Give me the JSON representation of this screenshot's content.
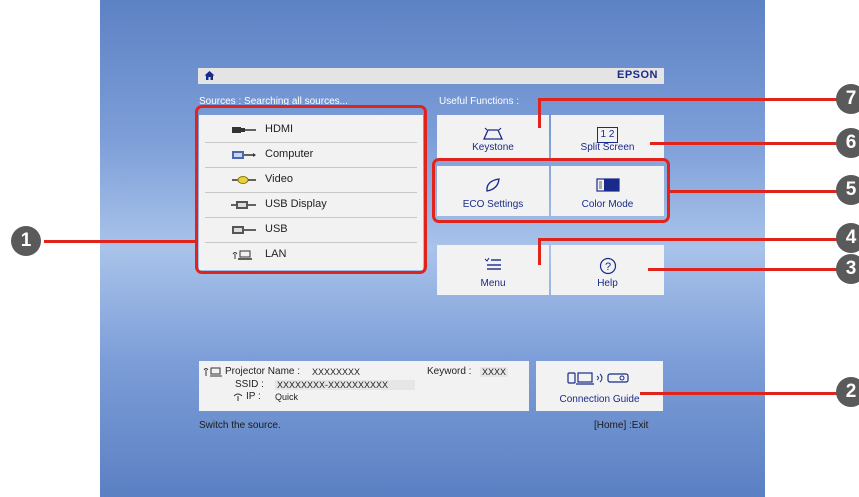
{
  "header": {
    "brand": "EPSON"
  },
  "sources": {
    "heading": "Sources :  Searching all sources...",
    "items": [
      {
        "label": "HDMI",
        "icon": "hdmi-icon"
      },
      {
        "label": "Computer",
        "icon": "computer-port-icon"
      },
      {
        "label": "Video",
        "icon": "video-port-icon"
      },
      {
        "label": "USB Display",
        "icon": "usb-display-icon"
      },
      {
        "label": "USB",
        "icon": "usb-icon"
      },
      {
        "label": "LAN",
        "icon": "lan-icon"
      }
    ]
  },
  "functions": {
    "heading": "Useful Functions :",
    "keystone": "Keystone",
    "split_screen": "Split Screen",
    "eco_settings": "ECO Settings",
    "color_mode": "Color Mode",
    "menu": "Menu",
    "help": "Help",
    "connection_guide": "Connection Guide",
    "split_icon_text": "1 2"
  },
  "network": {
    "projector_name_label": "Projector Name :",
    "projector_name_value": "XXXXXXXX",
    "keyword_label": "Keyword :",
    "keyword_value": "XXXX",
    "ssid_label": "SSID :",
    "ssid_value": "XXXXXXXX-XXXXXXXXXX",
    "ip_label": "IP :",
    "ip_value": "Quick"
  },
  "status": {
    "hint": "Switch the source.",
    "exit": "[Home] :Exit"
  },
  "callouts": [
    "1",
    "2",
    "3",
    "4",
    "5",
    "6",
    "7"
  ],
  "colors": {
    "callout": "#e0241c",
    "brand": "#1a2a8a",
    "badge": "#5a5a5a"
  }
}
